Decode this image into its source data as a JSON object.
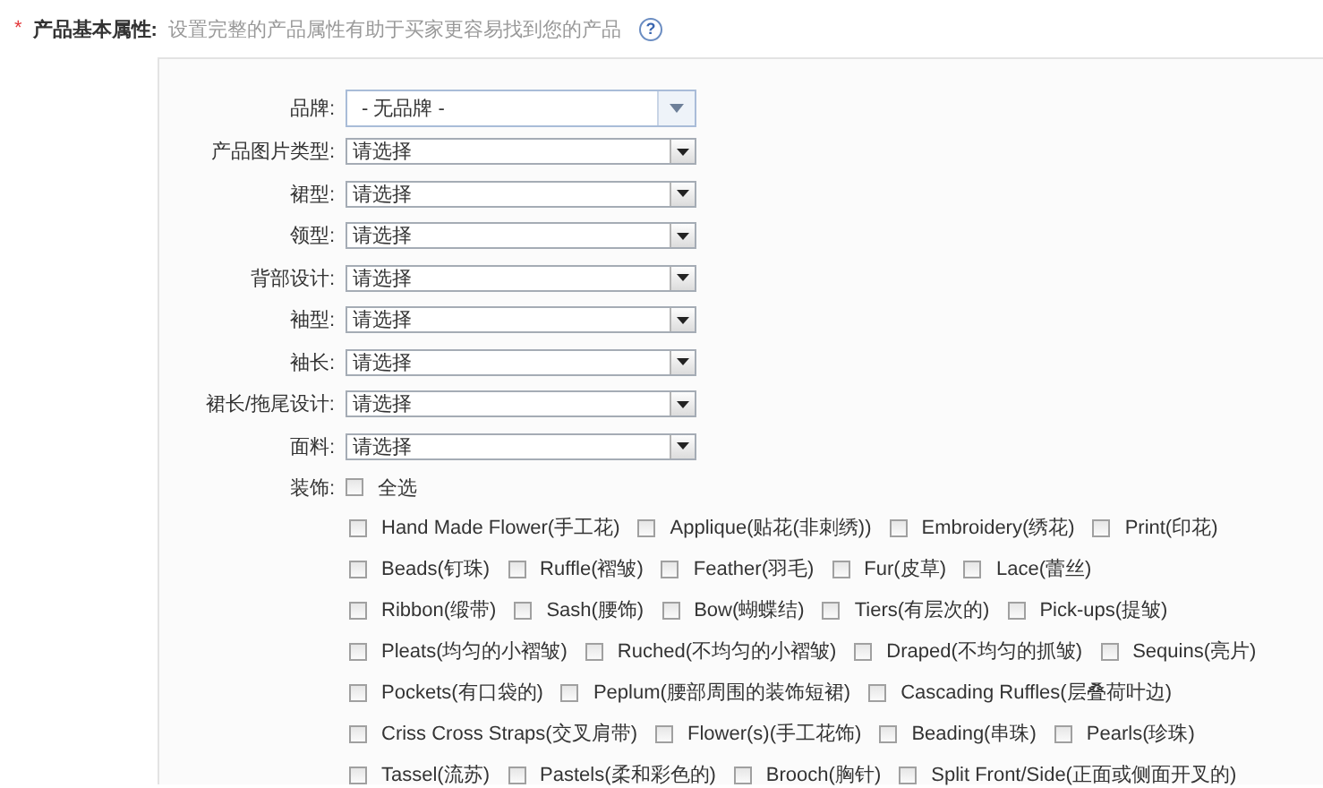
{
  "section": {
    "required_mark": "*",
    "title": "产品基本属性:",
    "hint": "设置完整的产品属性有助于买家更容易找到您的产品",
    "help_icon_text": "?"
  },
  "fields": [
    {
      "kind": "brand",
      "label": "品牌:",
      "value": "- 无品牌 -"
    },
    {
      "kind": "select",
      "label": "产品图片类型:",
      "value": "请选择"
    },
    {
      "kind": "select",
      "label": "裙型:",
      "value": "请选择"
    },
    {
      "kind": "select",
      "label": "领型:",
      "value": "请选择"
    },
    {
      "kind": "select",
      "label": "背部设计:",
      "value": "请选择"
    },
    {
      "kind": "select",
      "label": "袖型:",
      "value": "请选择"
    },
    {
      "kind": "select",
      "label": "袖长:",
      "value": "请选择"
    },
    {
      "kind": "select",
      "label": "裙长/拖尾设计:",
      "value": "请选择"
    },
    {
      "kind": "select",
      "label": "面料:",
      "value": "请选择"
    }
  ],
  "decoration": {
    "label": "装饰:",
    "select_all": {
      "label": "全选",
      "checked": false
    },
    "rows": [
      [
        {
          "label": "Hand Made Flower(手工花)",
          "checked": false
        },
        {
          "label": "Applique(贴花(非刺绣))",
          "checked": false
        },
        {
          "label": "Embroidery(绣花)",
          "checked": false
        },
        {
          "label": "Print(印花)",
          "checked": false
        }
      ],
      [
        {
          "label": "Beads(钉珠)",
          "checked": false
        },
        {
          "label": "Ruffle(褶皱)",
          "checked": false
        },
        {
          "label": "Feather(羽毛)",
          "checked": false
        },
        {
          "label": "Fur(皮草)",
          "checked": false
        },
        {
          "label": "Lace(蕾丝)",
          "checked": false
        }
      ],
      [
        {
          "label": "Ribbon(缎带)",
          "checked": false
        },
        {
          "label": "Sash(腰饰)",
          "checked": false
        },
        {
          "label": "Bow(蝴蝶结)",
          "checked": false
        },
        {
          "label": "Tiers(有层次的)",
          "checked": false
        },
        {
          "label": "Pick-ups(提皱)",
          "checked": false
        }
      ],
      [
        {
          "label": "Pleats(均匀的小褶皱)",
          "checked": false
        },
        {
          "label": "Ruched(不均匀的小褶皱)",
          "checked": false
        },
        {
          "label": "Draped(不均匀的抓皱)",
          "checked": false
        },
        {
          "label": "Sequins(亮片)",
          "checked": false
        }
      ],
      [
        {
          "label": "Pockets(有口袋的)",
          "checked": false
        },
        {
          "label": "Peplum(腰部周围的装饰短裙)",
          "checked": false
        },
        {
          "label": "Cascading Ruffles(层叠荷叶边)",
          "checked": false
        }
      ],
      [
        {
          "label": "Criss Cross Straps(交叉肩带)",
          "checked": false
        },
        {
          "label": "Flower(s)(手工花饰)",
          "checked": false
        },
        {
          "label": "Beading(串珠)",
          "checked": false
        },
        {
          "label": "Pearls(珍珠)",
          "checked": false
        }
      ],
      [
        {
          "label": "Tassel(流苏)",
          "checked": false
        },
        {
          "label": "Pastels(柔和彩色的)",
          "checked": false
        },
        {
          "label": "Brooch(胸针)",
          "checked": false
        },
        {
          "label": "Split Front/Side(正面或侧面开叉的)",
          "checked": false
        }
      ]
    ]
  }
}
